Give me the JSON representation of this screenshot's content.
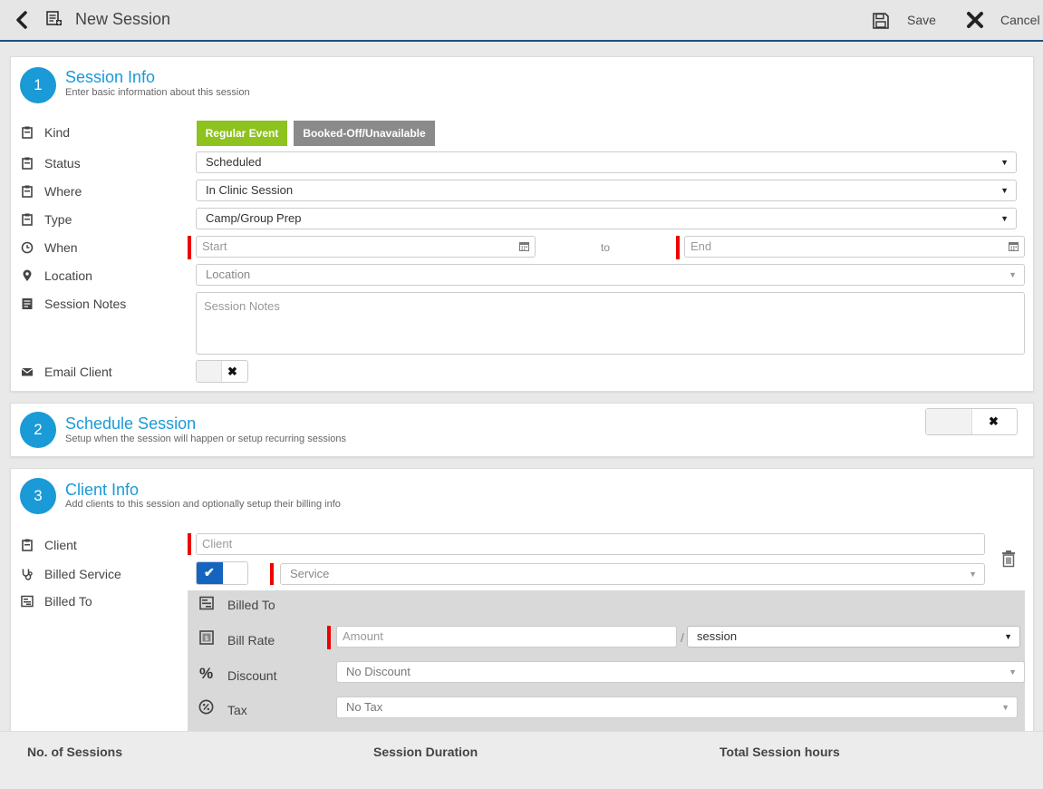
{
  "header": {
    "title": "New Session",
    "save_label": "Save",
    "cancel_label": "Cancel"
  },
  "session_info": {
    "step": "1",
    "title": "Session Info",
    "subtitle": "Enter basic information about this session",
    "kind": {
      "label": "Kind",
      "options": [
        "Regular Event",
        "Booked-Off/Unavailable"
      ],
      "selected": "Regular Event"
    },
    "status": {
      "label": "Status",
      "value": "Scheduled"
    },
    "where": {
      "label": "Where",
      "value": "In Clinic Session"
    },
    "type": {
      "label": "Type",
      "value": "Camp/Group Prep"
    },
    "when": {
      "label": "When",
      "start_placeholder": "Start",
      "to": "to",
      "end_placeholder": "End"
    },
    "location": {
      "label": "Location",
      "placeholder": "Location"
    },
    "notes": {
      "label": "Session Notes",
      "placeholder": "Session Notes"
    },
    "email_client": {
      "label": "Email Client",
      "enabled": false
    }
  },
  "schedule_session": {
    "step": "2",
    "title": "Schedule Session",
    "subtitle": "Setup when the session will happen or setup recurring sessions",
    "enabled": false
  },
  "client_info": {
    "step": "3",
    "title": "Client Info",
    "subtitle": "Add clients to this session and optionally setup their billing info",
    "client": {
      "label": "Client",
      "placeholder": "Client"
    },
    "billed_service": {
      "label": "Billed Service",
      "enabled": true,
      "placeholder": "Service"
    },
    "billed_to": {
      "label": "Billed To"
    },
    "billing": {
      "billed_to_label": "Billed To",
      "bill_rate": {
        "label": "Bill Rate",
        "amount_placeholder": "Amount",
        "separator": "/",
        "unit": "session"
      },
      "discount": {
        "label": "Discount",
        "value": "No Discount"
      },
      "tax": {
        "label": "Tax",
        "value": "No Tax"
      }
    }
  },
  "footer": {
    "sessions_label": "No. of Sessions",
    "duration_label": "Session Duration",
    "hours_label": "Total Session hours"
  },
  "colors": {
    "accent": "#1a9ad6",
    "active_kind": "#8dc21f",
    "inactive_kind": "#8a8a8a",
    "required": "#e00000",
    "toggle_on": "#1565c0"
  }
}
